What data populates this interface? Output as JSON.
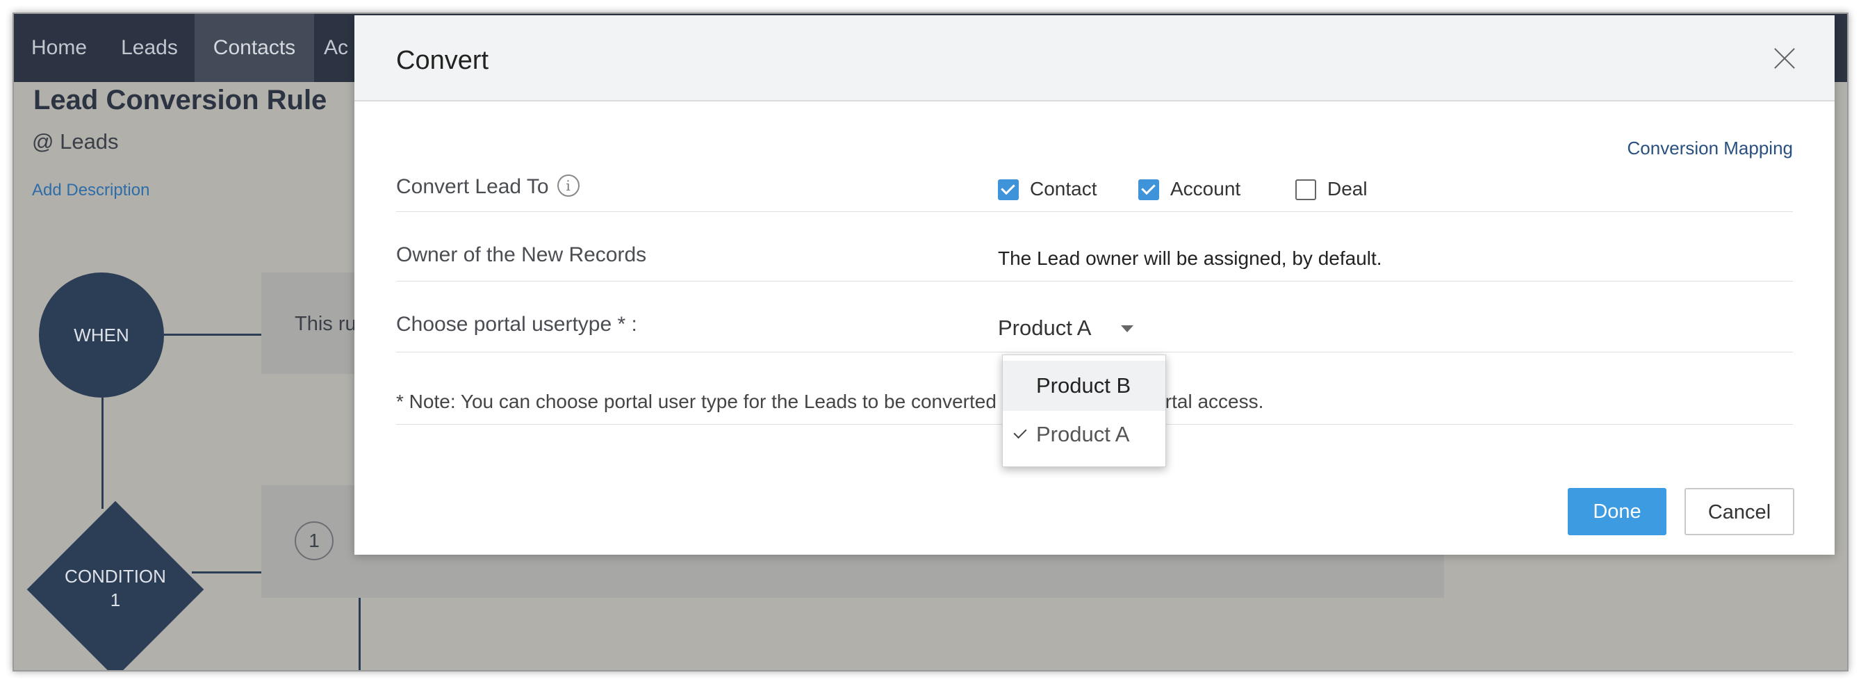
{
  "nav": {
    "items": [
      {
        "label": "Home"
      },
      {
        "label": "Leads"
      },
      {
        "label": "Contacts",
        "active": true
      },
      {
        "label": "Ac"
      }
    ]
  },
  "background": {
    "title": "Lead Conversion Rule",
    "module": "@ Leads",
    "add_description": "Add Description",
    "when_label": "WHEN",
    "rule_text_partial": "This ru",
    "condition_label_line1": "CONDITION",
    "condition_label_line2": "1",
    "condition_number": "1"
  },
  "modal": {
    "title": "Convert",
    "conversion_mapping": "Conversion Mapping",
    "convert_lead_to_label": "Convert Lead To",
    "info_glyph": "i",
    "options": [
      {
        "label": "Contact",
        "checked": true
      },
      {
        "label": "Account",
        "checked": true
      },
      {
        "label": "Deal",
        "checked": false
      }
    ],
    "owner_label": "Owner of the New Records",
    "owner_value": "The Lead owner will be assigned, by default.",
    "portal_label": "Choose portal usertype * :",
    "portal_selected": "Product A",
    "note": "* Note: You can choose portal user type for the Leads to be converted and granted the portal access.",
    "dropdown_options": [
      {
        "label": "Product B",
        "selected": false
      },
      {
        "label": "Product A",
        "selected": true
      }
    ],
    "done_label": "Done",
    "cancel_label": "Cancel"
  },
  "colors": {
    "nav_bg": "#2c3443",
    "accent_blue": "#3d9be1",
    "diagram_navy": "#2c3d56",
    "overlay_gray": "#b1b0aa"
  }
}
